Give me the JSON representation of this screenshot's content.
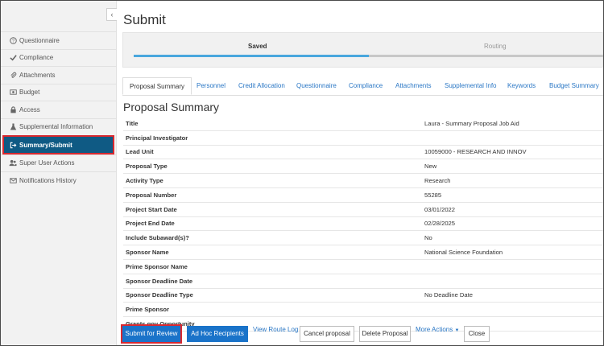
{
  "sidebar": {
    "items": [
      {
        "label": "Questionnaire",
        "icon": "question-circle-icon"
      },
      {
        "label": "Compliance",
        "icon": "checkmark-icon"
      },
      {
        "label": "Attachments",
        "icon": "paperclip-icon"
      },
      {
        "label": "Budget",
        "icon": "budget-icon"
      },
      {
        "label": "Access",
        "icon": "lock-icon"
      },
      {
        "label": "Supplemental Information",
        "icon": "flask-icon"
      },
      {
        "label": "Summary/Submit",
        "icon": "sign-out-icon",
        "active": true
      },
      {
        "label": "Super User Actions",
        "icon": "users-icon"
      },
      {
        "label": "Notifications History",
        "icon": "envelope-icon"
      }
    ]
  },
  "header": {
    "title": "Submit"
  },
  "route": {
    "steps": [
      "Saved",
      "Routing"
    ],
    "current_step": "Saved",
    "progress": 0.5,
    "progress_color": "#49a7dd"
  },
  "tabs": [
    {
      "label": "Proposal Summary",
      "active": true
    },
    {
      "label": "Personnel"
    },
    {
      "label": "Credit Allocation"
    },
    {
      "label": "Questionnaire"
    },
    {
      "label": "Compliance"
    },
    {
      "label": "Attachments"
    },
    {
      "label": "Supplemental Info"
    },
    {
      "label": "Keywords"
    },
    {
      "label": "Budget Summary"
    }
  ],
  "summary": {
    "title": "Proposal Summary",
    "rows": [
      {
        "label": "Title",
        "value": "Laura - Summary Proposal Job Aid"
      },
      {
        "label": "Principal Investigator",
        "value": ""
      },
      {
        "label": "Lead Unit",
        "value": "10059000 - RESEARCH AND INNOV"
      },
      {
        "label": "Proposal Type",
        "value": "New"
      },
      {
        "label": "Activity Type",
        "value": "Research"
      },
      {
        "label": "Proposal Number",
        "value": "55285"
      },
      {
        "label": "Project Start Date",
        "value": "03/01/2022"
      },
      {
        "label": "Project End Date",
        "value": "02/28/2025"
      },
      {
        "label": "Include Subaward(s)?",
        "value": "No"
      },
      {
        "label": "Sponsor Name",
        "value": "National Science Foundation"
      },
      {
        "label": "Prime Sponsor Name",
        "value": ""
      },
      {
        "label": "Sponsor Deadline Date",
        "value": ""
      },
      {
        "label": "Sponsor Deadline Type",
        "value": "No Deadline Date"
      },
      {
        "label": "Prime Sponsor",
        "value": ""
      },
      {
        "label": "Grants.gov Opportunity",
        "value": ""
      }
    ]
  },
  "actions": {
    "submit_for_review": "Submit for Review",
    "ad_hoc_recipients": "Ad Hoc Recipients",
    "view_route_log": "View Route Log",
    "cancel_proposal": "Cancel proposal",
    "delete_proposal": "Delete Proposal",
    "more_actions": "More Actions",
    "close": "Close"
  },
  "colors": {
    "accent": "#1a73c9",
    "active_nav": "#0f5a84",
    "highlight": "#d9282f"
  }
}
